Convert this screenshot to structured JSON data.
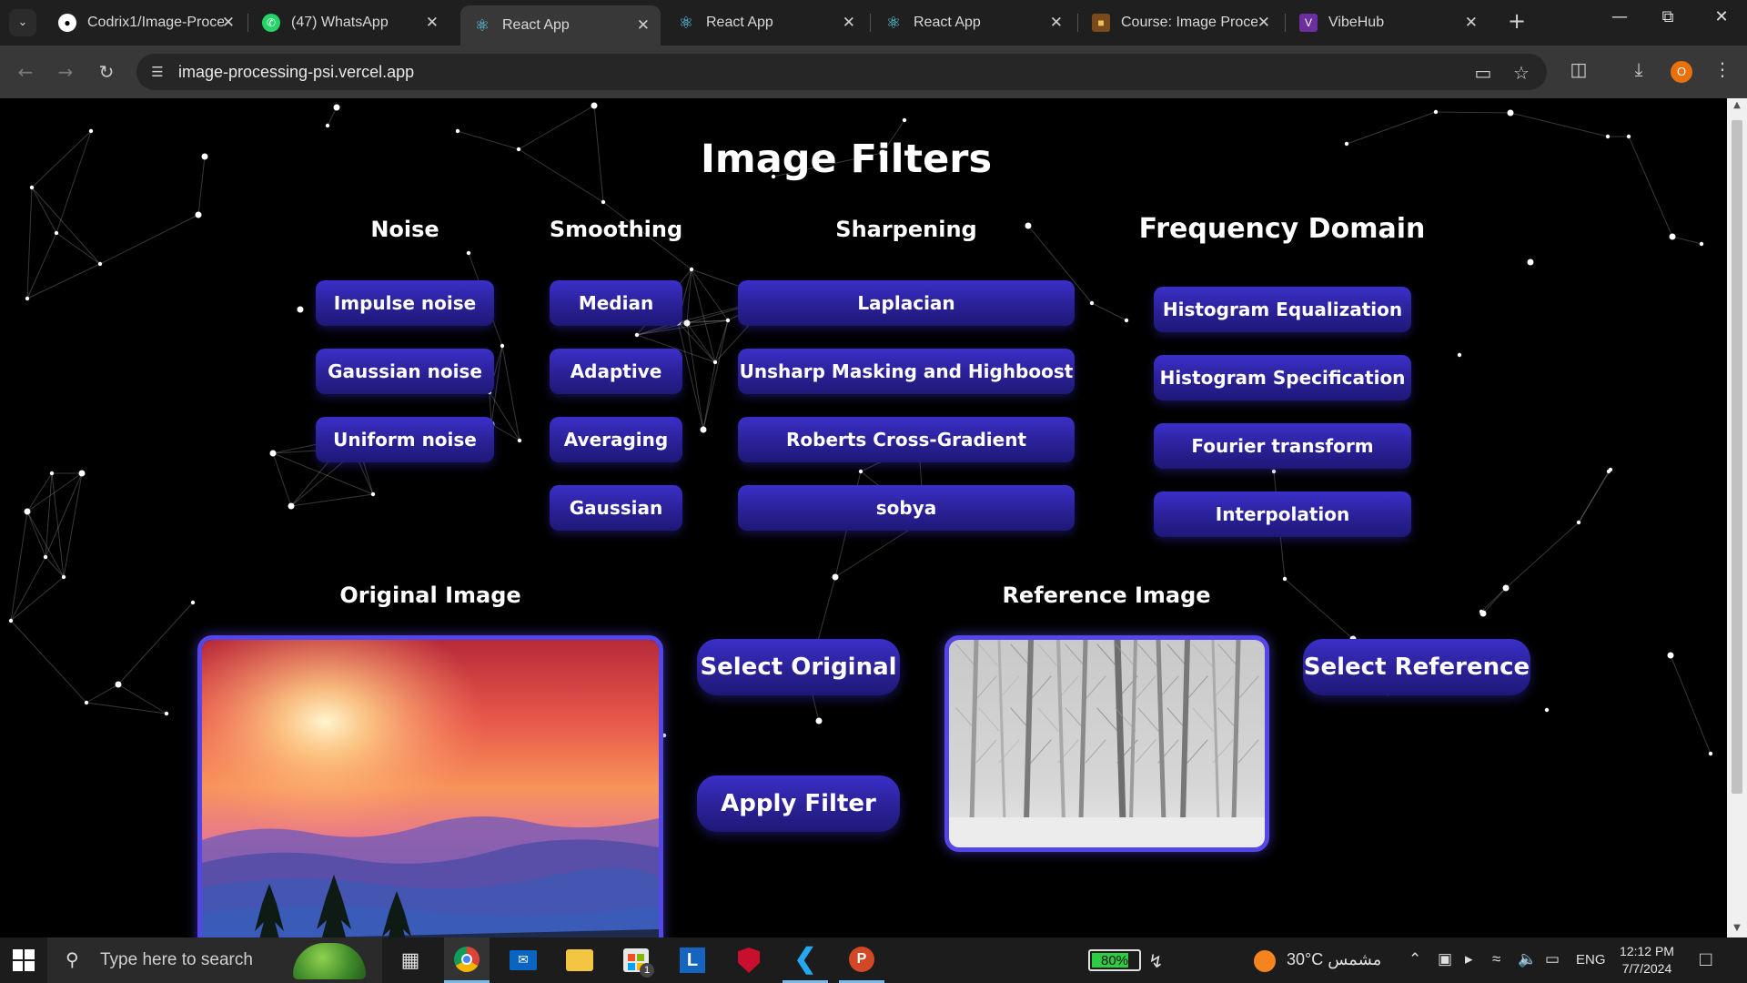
{
  "browser": {
    "tabs": [
      {
        "title": "Codrix1/Image-Proce",
        "icon": "github-icon"
      },
      {
        "title": "(47) WhatsApp",
        "icon": "whatsapp-icon"
      },
      {
        "title": "React App",
        "icon": "react-icon",
        "active": true
      },
      {
        "title": "React App",
        "icon": "react-icon"
      },
      {
        "title": "React App",
        "icon": "react-icon"
      },
      {
        "title": "Course: Image Proce",
        "icon": "course-icon"
      },
      {
        "title": "VibeHub",
        "icon": "vibehub-icon"
      }
    ],
    "url": "image-processing-psi.vercel.app",
    "profile_initial": "O"
  },
  "page": {
    "title": "Image Filters",
    "columns": {
      "noise": {
        "title": "Noise",
        "buttons": [
          "Impulse noise",
          "Gaussian noise",
          "Uniform noise"
        ]
      },
      "smoothing": {
        "title": "Smoothing",
        "buttons": [
          "Median",
          "Adaptive",
          "Averaging",
          "Gaussian"
        ]
      },
      "sharpening": {
        "title": "Sharpening",
        "buttons": [
          "Laplacian",
          "Unsharp Masking and Highboost",
          "Roberts Cross-Gradient",
          "sobya"
        ]
      },
      "frequency": {
        "title": "Frequency Domain",
        "buttons": [
          "Histogram Equalization",
          "Histogram Specification",
          "Fourier transform",
          "Interpolation"
        ]
      }
    },
    "original_label": "Original Image",
    "reference_label": "Reference Image",
    "select_original": "Select Original",
    "select_reference": "Select Reference",
    "apply_filter": "Apply Filter",
    "accent_color": "#3b2fc9",
    "frame_color": "#5446e8"
  },
  "taskbar": {
    "search_placeholder": "Type here to search",
    "battery": "80%",
    "battery_level": 0.8,
    "weather": "30°C  مشمس",
    "language": "ENG",
    "time": "12:12 PM",
    "date": "7/7/2024",
    "store_badge": "1"
  }
}
